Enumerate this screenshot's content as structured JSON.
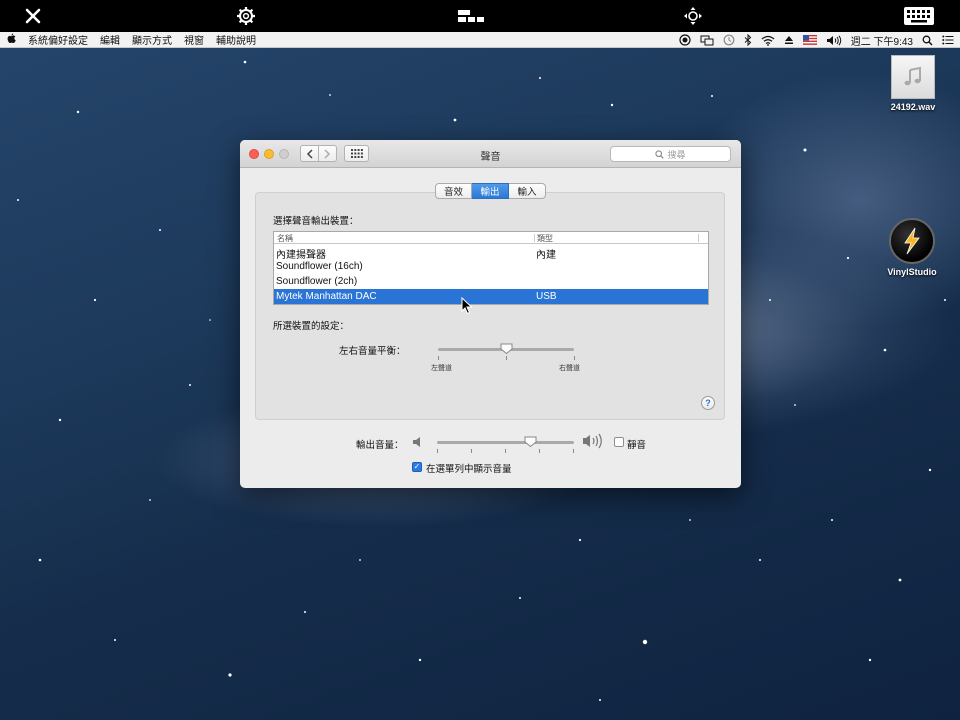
{
  "menubar": {
    "items": [
      "系統偏好設定",
      "編輯",
      "顯示方式",
      "視窗",
      "輔助說明"
    ],
    "clock": "週二 下午9:43"
  },
  "desktop": {
    "icons": [
      {
        "label": "24192.wav",
        "icon": "music-file-icon"
      },
      {
        "label": "VinylStudio",
        "icon": "vinylstudio-app-icon"
      }
    ]
  },
  "window": {
    "title": "聲音",
    "search_placeholder": "搜尋",
    "tabs": [
      {
        "label": "音效",
        "active": false
      },
      {
        "label": "輸出",
        "active": true
      },
      {
        "label": "輸入",
        "active": false
      }
    ],
    "output_device_heading": "選擇聲音輸出裝置：",
    "table": {
      "columns": [
        "名稱",
        "類型"
      ],
      "rows": [
        {
          "name": "內建揚聲器",
          "type": "內建",
          "selected": false
        },
        {
          "name": "Soundflower (16ch)",
          "type": "",
          "selected": false
        },
        {
          "name": "Soundflower (2ch)",
          "type": "",
          "selected": false
        },
        {
          "name": "Mytek Manhattan DAC",
          "type": "USB",
          "selected": true
        }
      ]
    },
    "device_settings_heading": "所選裝置的設定：",
    "balance": {
      "label": "左右音量平衡：",
      "left_label": "左聲道",
      "right_label": "右聲道",
      "value": 0.5
    },
    "output_volume": {
      "label": "輸出音量：",
      "value": 0.68
    },
    "mute": {
      "label": "靜音",
      "checked": false
    },
    "show_in_menubar": {
      "label": "在選單列中顯示音量",
      "checked": true
    },
    "help": "?"
  }
}
